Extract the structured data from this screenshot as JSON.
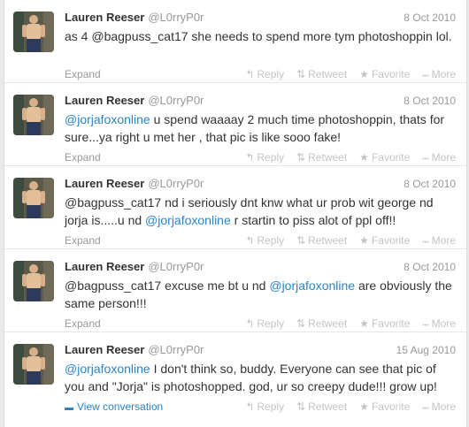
{
  "tweets": [
    {
      "name": "Lauren Reeser",
      "handle": "@L0rryP0r",
      "date": "8 Oct 2010",
      "text": [
        {
          "t": "as 4 @bagpuss_cat17 she needs to spend more tym photoshoppin lol.",
          "m": false
        }
      ],
      "footer_link": "Expand",
      "footer_type": "expand"
    },
    {
      "name": "Lauren Reeser",
      "handle": "@L0rryP0r",
      "date": "8 Oct 2010",
      "text": [
        {
          "t": "@jorjafoxonline",
          "m": true
        },
        {
          "t": " u spend waaaay 2 much time photoshoppin, thats for sure...ya right u met her , that pic is like sooo fake!",
          "m": false
        }
      ],
      "footer_link": "Expand",
      "footer_type": "expand"
    },
    {
      "name": "Lauren Reeser",
      "handle": "@L0rryP0r",
      "date": "8 Oct 2010",
      "text": [
        {
          "t": "@bagpuss_cat17 nd i seriously dnt knw what ur prob wit george nd jorja is.....u nd ",
          "m": false
        },
        {
          "t": "@jorjafoxonline",
          "m": true
        },
        {
          "t": " r startin to piss alot of ppl off!!",
          "m": false
        }
      ],
      "footer_link": "Expand",
      "footer_type": "expand"
    },
    {
      "name": "Lauren Reeser",
      "handle": "@L0rryP0r",
      "date": "8 Oct 2010",
      "text": [
        {
          "t": "@bagpuss_cat17 excuse me bt u nd ",
          "m": false
        },
        {
          "t": "@jorjafoxonline",
          "m": true
        },
        {
          "t": " are obviously the same person!!!",
          "m": false
        }
      ],
      "footer_link": "Expand",
      "footer_type": "expand"
    },
    {
      "name": "Lauren Reeser",
      "handle": "@L0rryP0r",
      "date": "15 Aug 2010",
      "text": [
        {
          "t": "@jorjafoxonline",
          "m": true
        },
        {
          "t": " I don't think so, buddy. Everyone can see that pic of you and \"Jorja\" is photoshopped. god, ur so creepy dude!!! grow up!",
          "m": false
        }
      ],
      "footer_link": "View conversation",
      "footer_type": "conversation"
    }
  ],
  "actions": {
    "reply": "Reply",
    "retweet": "Retweet",
    "favorite": "Favorite",
    "more": "More"
  },
  "icons": {
    "reply": "reply-icon",
    "retweet": "retweet-icon",
    "favorite": "star-icon",
    "more": "more-icon",
    "conversation": "speech-bubble-icon"
  },
  "colors": {
    "link": "#2a84c6",
    "muted": "#999999",
    "action": "#c4c4c4",
    "name": "#333333"
  }
}
